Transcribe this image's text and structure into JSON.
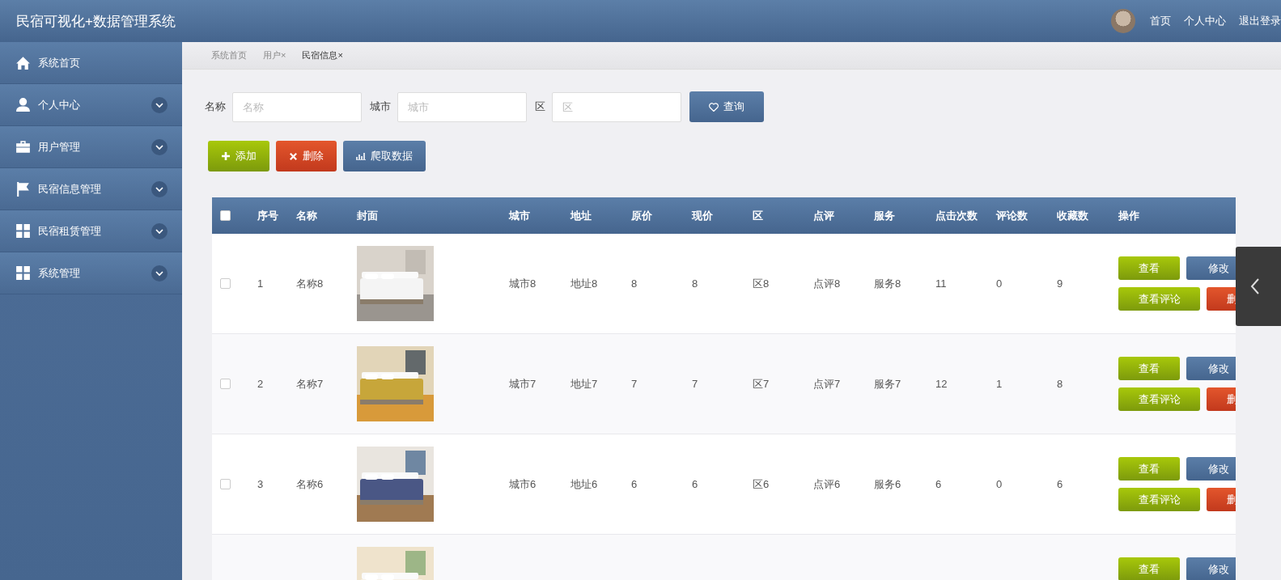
{
  "header": {
    "title": "民宿可视化+数据管理系统",
    "links": [
      "首页",
      "个人中心",
      "退出登录"
    ]
  },
  "sidebar": {
    "items": [
      {
        "kind": "home",
        "label": "系统首页"
      },
      {
        "kind": "user",
        "label": "个人中心",
        "expanded": false
      },
      {
        "kind": "briefcase",
        "label": "用户管理",
        "expanded": false
      },
      {
        "kind": "flag",
        "label": "民宿信息管理",
        "expanded": false
      },
      {
        "kind": "grid",
        "label": "民宿租赁管理",
        "expanded": false
      },
      {
        "kind": "grid",
        "label": "系统管理",
        "expanded": false
      }
    ]
  },
  "breadcrumb": [
    {
      "label": "系统首页",
      "selected": false
    },
    {
      "label": "用户",
      "close": "×",
      "selected": false
    },
    {
      "label": "民宿信息",
      "close": "×",
      "selected": true
    }
  ],
  "search": {
    "fields": [
      {
        "label": "名称",
        "placeholder": "名称"
      },
      {
        "label": "城市",
        "placeholder": "城市"
      },
      {
        "label": "区",
        "placeholder": "区"
      }
    ],
    "button": "查询"
  },
  "toolbar": [
    {
      "kind": "add",
      "label": "添加"
    },
    {
      "kind": "delete",
      "label": "删除"
    },
    {
      "kind": "crawl",
      "label": "爬取数据"
    }
  ],
  "table": {
    "select_all_checked": false,
    "columns": [
      "序号",
      "名称",
      "封面",
      "城市",
      "地址",
      "原价",
      "现价",
      "区",
      "点评",
      "服务",
      "点击次数",
      "评论数",
      "收藏数",
      "操作"
    ],
    "rows": [
      {
        "checked": false,
        "cells": [
          "1",
          "名称8"
        ],
        "cover": {
          "kind": "picture"
        },
        "rest": [
          "城市8",
          "地址8",
          "8",
          "8",
          "区8",
          "点评8",
          "服务8",
          "11",
          "0",
          "9"
        ],
        "actions": [
          "查看",
          "修改",
          "查看评论",
          "删"
        ]
      },
      {
        "checked": false,
        "cells": [
          "2",
          "名称7"
        ],
        "cover": {
          "kind": "picture"
        },
        "rest": [
          "城市7",
          "地址7",
          "7",
          "7",
          "区7",
          "点评7",
          "服务7",
          "12",
          "1",
          "8"
        ],
        "actions": [
          "查看",
          "修改",
          "查看评论",
          "删"
        ]
      },
      {
        "checked": false,
        "cells": [
          "3",
          "名称6"
        ],
        "cover": {
          "kind": "picture"
        },
        "rest": [
          "城市6",
          "地址6",
          "6",
          "6",
          "区6",
          "点评6",
          "服务6",
          "6",
          "0",
          "6"
        ],
        "actions": [
          "查看",
          "修改",
          "查看评论",
          "删"
        ]
      },
      {
        "cells": [],
        "cover": {
          "kind": "picture"
        },
        "rest": [],
        "actions": [
          "查看",
          "修改"
        ]
      }
    ]
  }
}
